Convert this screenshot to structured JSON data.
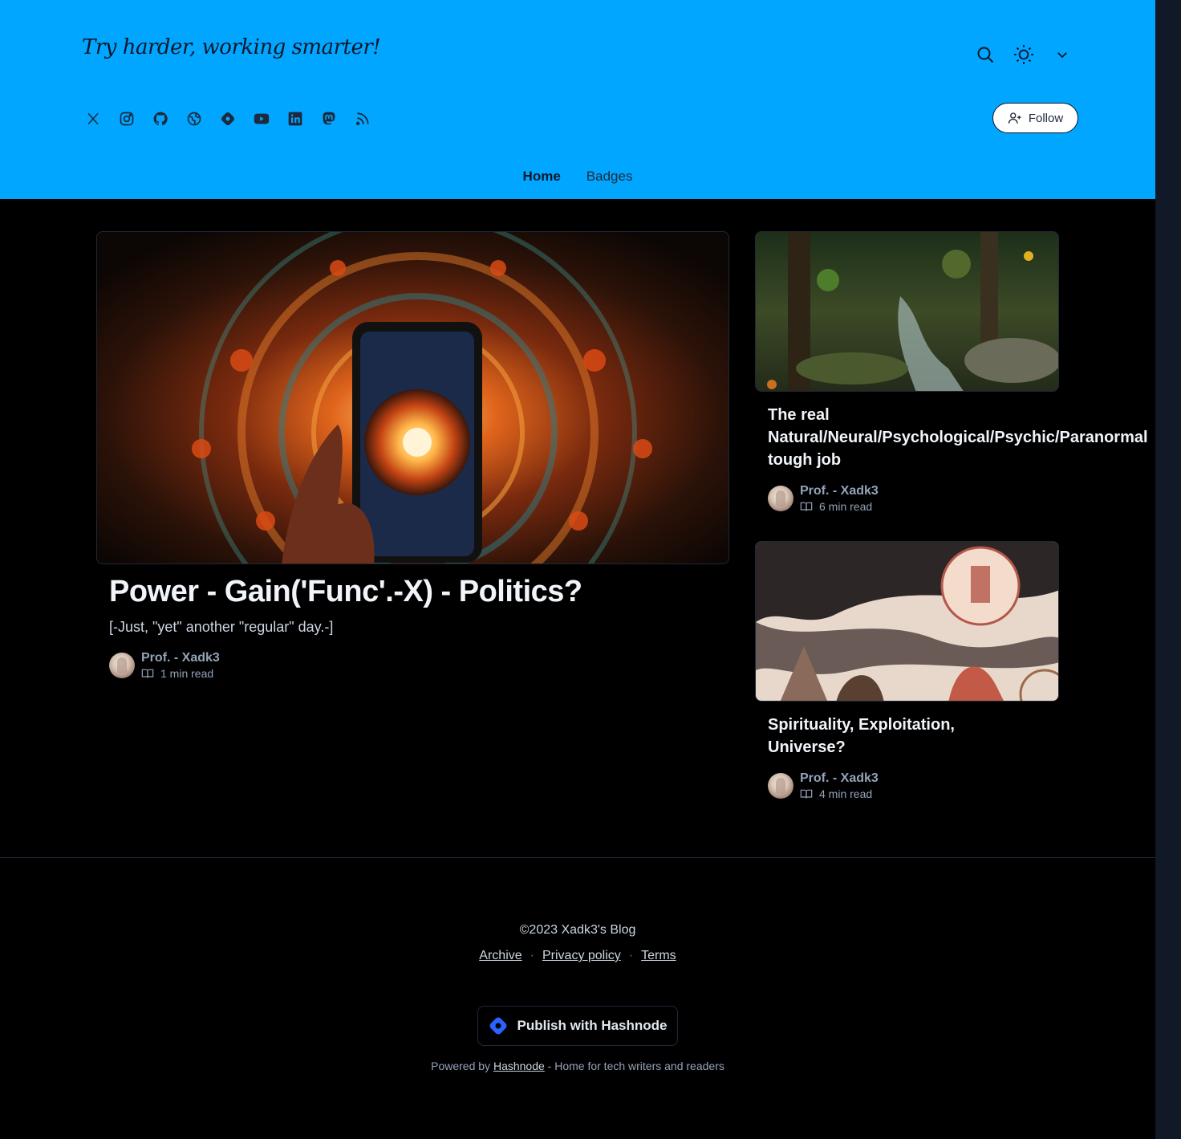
{
  "header": {
    "logo_text": "Try harder, working smarter!",
    "follow_label": "Follow",
    "colors": {
      "background": "#00a6ff",
      "text": "#0f172a"
    }
  },
  "header_icons": [
    "search-icon",
    "sun-icon",
    "chevron-down-icon"
  ],
  "social_icons": [
    "x-icon",
    "instagram-icon",
    "github-icon",
    "globe-icon",
    "hashnode-icon",
    "youtube-icon",
    "linkedin-icon",
    "mastodon-icon",
    "rss-icon"
  ],
  "nav": {
    "home": "Home",
    "badges": "Badges"
  },
  "main_post": {
    "title": "Power - Gain('Func'.-X) - Politics?",
    "subtitle": "[-Just, \"yet\" another \"regular\" day.-]",
    "author": "Prof. - Xadk3",
    "read_time": "1 min read"
  },
  "side_posts": [
    {
      "title_line1": "The real",
      "title_line2": "Natural/Neural/Psychological/Psychic/Paranormal",
      "title_line3": "tough job",
      "author": "Prof. - Xadk3",
      "read_time": "6 min read"
    },
    {
      "title_line1": "Spirituality, Exploitation,",
      "title_line2": "Universe?",
      "author": "Prof. - Xadk3",
      "read_time": "4 min read"
    }
  ],
  "footer": {
    "copyright": "©2023 Xadk3's Blog",
    "links": [
      "Archive",
      "Privacy policy",
      "Terms"
    ],
    "publish_label": "Publish with Hashnode",
    "powered_prefix": "Powered by",
    "powered_link": "Hashnode",
    "powered_suffix": "- Home for tech writers and readers"
  }
}
